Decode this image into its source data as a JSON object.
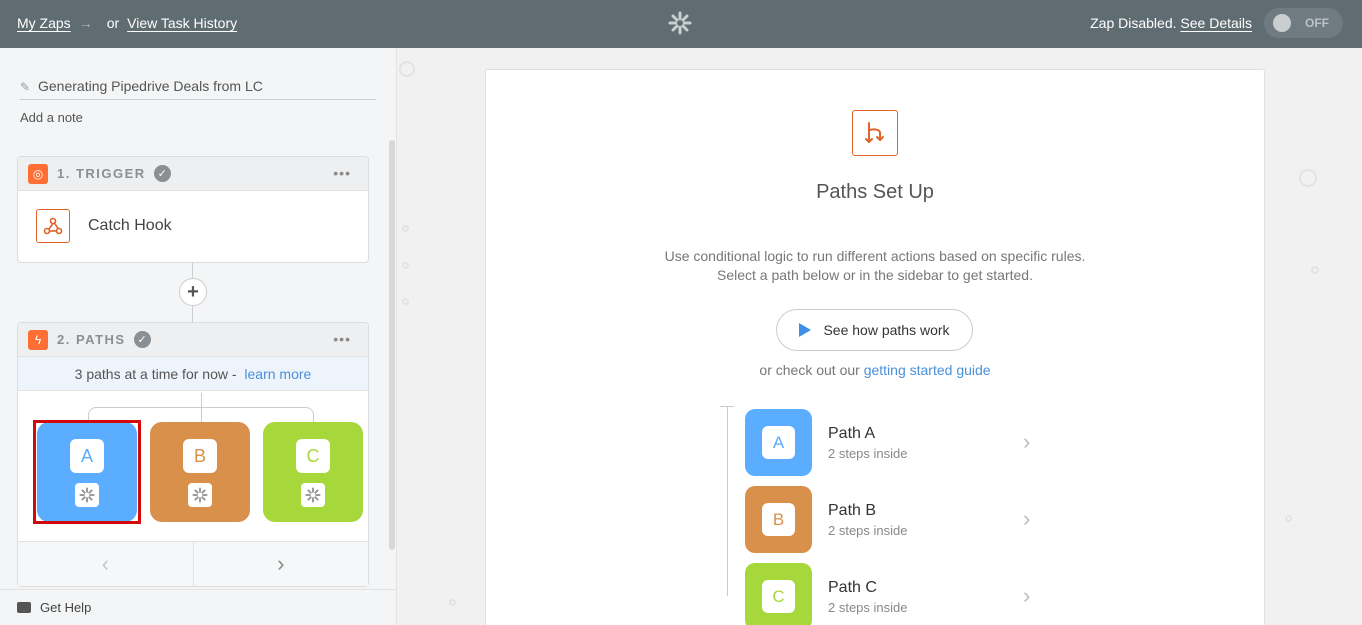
{
  "topbar": {
    "my_zaps": "My Zaps",
    "arrow": "→",
    "or": "or",
    "task_history": "View Task History",
    "status_text": "Zap Disabled.",
    "see_details": "See Details",
    "toggle_label": "OFF"
  },
  "sidebar": {
    "zap_name": "Generating Pipedrive Deals from LC",
    "add_note": "Add a note",
    "trigger": {
      "title": "1. TRIGGER",
      "app": "Catch Hook",
      "more": "•••"
    },
    "add_step": "+",
    "paths_step": {
      "title": "2. PATHS",
      "more": "•••",
      "note": "3 paths at a time for now -",
      "note_link": "learn more",
      "tiles": [
        {
          "letter": "A"
        },
        {
          "letter": "B"
        },
        {
          "letter": "C"
        }
      ],
      "prev": "‹",
      "next": "›"
    },
    "get_help": "Get Help"
  },
  "main": {
    "title": "Paths Set Up",
    "desc_line1": "Use conditional logic to run different actions based on specific rules.",
    "desc_line2": "Select a path below or in the sidebar to get started.",
    "see_button": "See how paths work",
    "or_check": "or check out our",
    "guide_link": "getting started guide",
    "paths": [
      {
        "letter": "A",
        "name": "Path A",
        "sub": "2 steps inside"
      },
      {
        "letter": "B",
        "name": "Path B",
        "sub": "2 steps inside"
      },
      {
        "letter": "C",
        "name": "Path C",
        "sub": "2 steps inside"
      }
    ]
  },
  "colors": {
    "topbar": "#5f6c72",
    "accent_orange": "#ff6e35",
    "path_a": "#5aadff",
    "path_b": "#d8904a",
    "path_c": "#a6d83b",
    "selection": "#d20a0a",
    "link": "#4a90d9"
  }
}
